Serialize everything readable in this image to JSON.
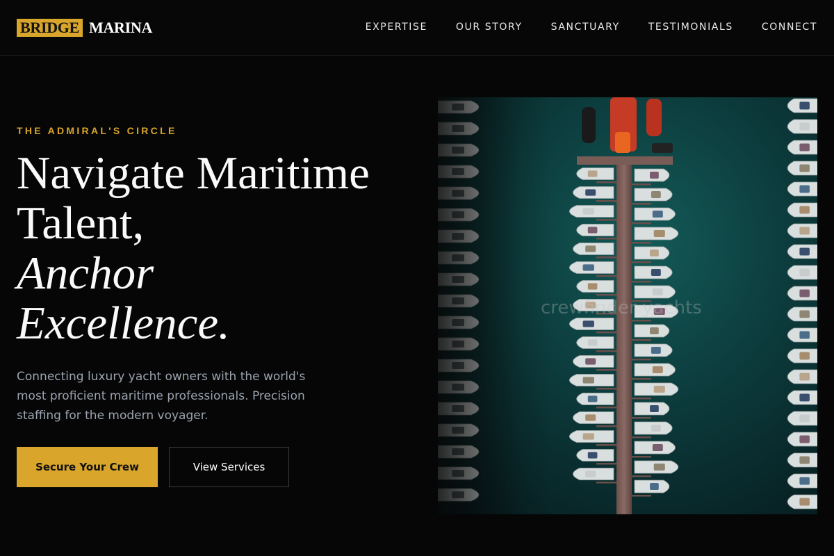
{
  "header": {
    "logo_part1": "BRIDGE",
    "logo_part2": "MARINA",
    "nav": [
      "EXPERTISE",
      "OUR STORY",
      "SANCTUARY",
      "TESTIMONIALS",
      "CONNECT"
    ]
  },
  "hero": {
    "eyebrow": "THE ADMIRAL'S CIRCLE",
    "headline_line1": "Navigate Maritime",
    "headline_line2": "Talent,",
    "headline_line3": "Anchor",
    "headline_line4": "Excellence.",
    "description": "Connecting luxury yacht owners with the world's most proficient maritime professionals. Precision staffing for the modern voyager.",
    "primary_cta": "Secure Your Crew",
    "secondary_cta": "View Services",
    "image_watermark": "crewfinder yachts"
  },
  "colors": {
    "accent": "#d9a52a",
    "background": "#060606",
    "water": "#0b2a2c"
  }
}
